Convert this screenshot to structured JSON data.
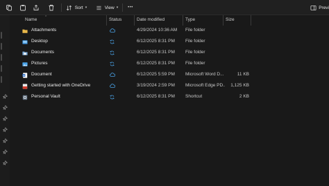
{
  "toolbar": {
    "sort_label": "Sort",
    "view_label": "View",
    "more_label": "•••",
    "preview_label": "Previ",
    "icons": [
      "copy-icon",
      "paste-icon",
      "share-icon",
      "delete-icon",
      "sort-icon",
      "view-icon",
      "more-icon",
      "preview-pane-icon"
    ]
  },
  "columns": {
    "name": "Name",
    "status": "Status",
    "date": "Date modified",
    "type": "Type",
    "size": "Size"
  },
  "files": [
    {
      "name": "Attachments",
      "icon": "folder",
      "status": "cloud",
      "date": "4/29/2024 10:36 AM",
      "type": "File folder",
      "size": ""
    },
    {
      "name": "Desktop",
      "icon": "desktop",
      "status": "sync",
      "date": "6/12/2025 8:31 PM",
      "type": "File folder",
      "size": ""
    },
    {
      "name": "Documents",
      "icon": "documents",
      "status": "sync",
      "date": "6/12/2025 8:31 PM",
      "type": "File folder",
      "size": ""
    },
    {
      "name": "Pictures",
      "icon": "pictures",
      "status": "sync",
      "date": "6/12/2025 8:31 PM",
      "type": "File folder",
      "size": ""
    },
    {
      "name": "Document",
      "icon": "word",
      "status": "cloud",
      "date": "6/12/2025 5:59 PM",
      "type": "Microsoft Word D...",
      "size": "11 KB"
    },
    {
      "name": "Getting started with OneDrive",
      "icon": "pdf",
      "status": "cloud",
      "date": "3/19/2024 2:59 PM",
      "type": "Microsoft Edge PD...",
      "size": "1,125 KB"
    },
    {
      "name": "Personal Vault",
      "icon": "vault",
      "status": "sync",
      "date": "6/12/2025 8:31 PM",
      "type": "Shortcut",
      "size": "2 KB"
    }
  ],
  "colors": {
    "background": "#191919",
    "folder": "#e8b84a",
    "accent": "#4aa3e8",
    "word": "#2b6cc4",
    "pdf": "#d23a2a"
  }
}
